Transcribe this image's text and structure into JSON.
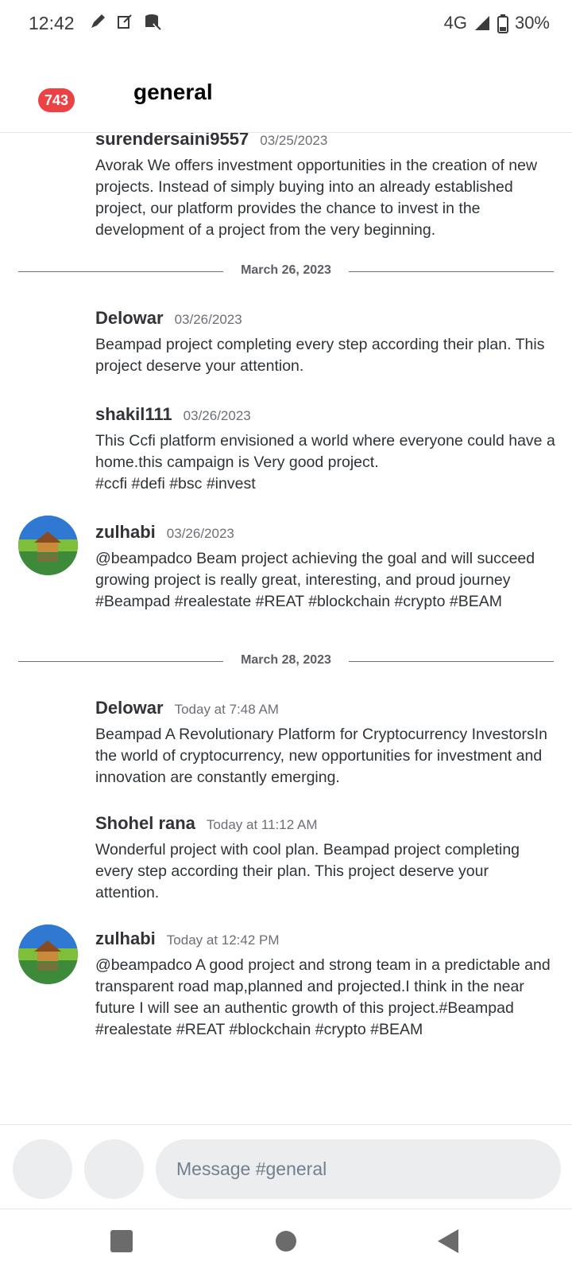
{
  "status_bar": {
    "time": "12:42",
    "network": "4G",
    "battery": "30%",
    "left_icons": [
      "pen-icon",
      "edit-icon",
      "database-icon"
    ],
    "right_icons": [
      "signal-icon",
      "battery-icon"
    ]
  },
  "header": {
    "unread_badge": "743",
    "channel_name": "general"
  },
  "messages": [
    {
      "author": "surendersaini9557",
      "time": "03/25/2023",
      "text": "Avorak We offers investment opportunities in the creation of new projects. Instead of simply buying into an already established project, our platform provides the chance to invest in the development of a project from the very beginning.",
      "has_avatar": false
    },
    {
      "author": "Delowar",
      "time": "03/26/2023",
      "text": "Beampad project completing every step according their plan. This project deserve your attention.",
      "has_avatar": false
    },
    {
      "author": "shakil111",
      "time": "03/26/2023",
      "text": "This Ccfi platform envisioned a world where everyone could have a home.this campaign is Very good project.\n#ccfi #defi #bsc #invest",
      "has_avatar": false
    },
    {
      "author": "zulhabi",
      "time": "03/26/2023",
      "text": "@beampadco Beam project achieving the goal and will succeed growing project is really great, interesting, and proud journey #Beampad #realestate #REAT #blockchain #crypto #BEAM",
      "has_avatar": true
    },
    {
      "author": "Delowar",
      "time": "Today at 7:48 AM",
      "text": "Beampad A Revolutionary Platform for Cryptocurrency InvestorsIn the world of cryptocurrency, new opportunities for investment and innovation are constantly emerging.",
      "has_avatar": false
    },
    {
      "author": "Shohel rana",
      "time": "Today at 11:12 AM",
      "text": "Wonderful project with cool plan. Beampad project completing every step according their plan. This project deserve your attention.",
      "has_avatar": false
    },
    {
      "author": "zulhabi",
      "time": "Today at 12:42 PM",
      "text": "@beampadco A good project and strong team in a predictable and transparent road map,planned and projected.I think in the near future I will see an authentic growth of this project.#Beampad #realestate #REAT #blockchain #crypto #BEAM",
      "has_avatar": true
    }
  ],
  "date_dividers": [
    "March 26, 2023",
    "March 28, 2023"
  ],
  "composer": {
    "placeholder": "Message #general",
    "value": ""
  },
  "nav": [
    "recents-button",
    "home-button",
    "back-button"
  ],
  "colors": {
    "badge": "#ed4245",
    "input_bg": "#ebedef",
    "divider_text": "#5c5e66"
  }
}
